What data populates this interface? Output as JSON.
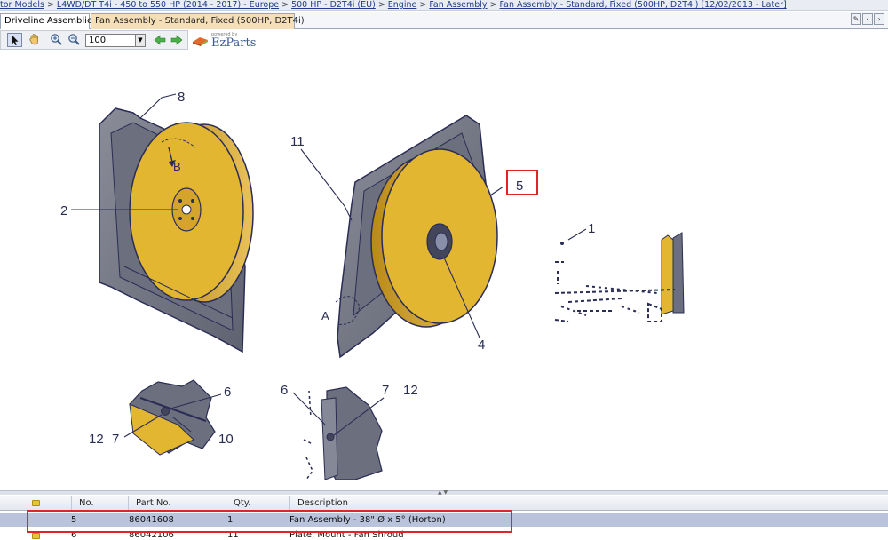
{
  "breadcrumb": [
    "tor Models",
    "L4WD/DT T4i - 450 to 550 HP (2014 - 2017) - Europe",
    "500 HP - D2T4i (EU)",
    "Engine",
    "Fan Assembly",
    "Fan Assembly - Standard, Fixed (500HP, D2T4i) [12/02/2013 - Later]"
  ],
  "breadcrumb_separator": ">",
  "tabs": [
    {
      "label": "Driveline Assemblies",
      "active": true
    },
    {
      "label": "Fan Assembly - Standard, Fixed (500HP, D2T4i)",
      "active": false
    }
  ],
  "toolbar": {
    "zoom_value": "100",
    "logo_powered": "powered by",
    "logo_name": "EzParts",
    "icons": [
      "select-arrow-icon",
      "pan-hand-icon",
      "zoom-in-icon",
      "zoom-out-icon",
      "back-arrow-icon",
      "forward-arrow-icon"
    ]
  },
  "window_buttons": [
    "pin-icon",
    "prev-icon",
    "next-icon"
  ],
  "callouts": {
    "c8": "8",
    "c11": "11",
    "c5": "5",
    "c2": "2",
    "c1": "1",
    "c4": "4",
    "cB": "B",
    "cA": "A",
    "c6a": "6",
    "c12a": "12",
    "c7a": "7",
    "c10": "10",
    "c6b": "6",
    "c7b": "7",
    "c12b": "12"
  },
  "table": {
    "headers": [
      "No.",
      "Part No.",
      "Qty.",
      "Description"
    ],
    "rows": [
      {
        "no": "5",
        "part": "86041608",
        "qty": "1",
        "desc": "Fan Assembly - 38\" Ø x 5° (Horton)",
        "selected": true
      },
      {
        "no": "6",
        "part": "86042106",
        "qty": "11",
        "desc": "Plate, Mount - Fan Shroud",
        "selected": false
      }
    ]
  },
  "colors": {
    "fan_yellow": "#e3b631",
    "shroud_gray": "#6f7280",
    "line_navy": "#2a2d55",
    "highlight_red": "#e0252a",
    "row_selected": "#b9c4dc"
  }
}
